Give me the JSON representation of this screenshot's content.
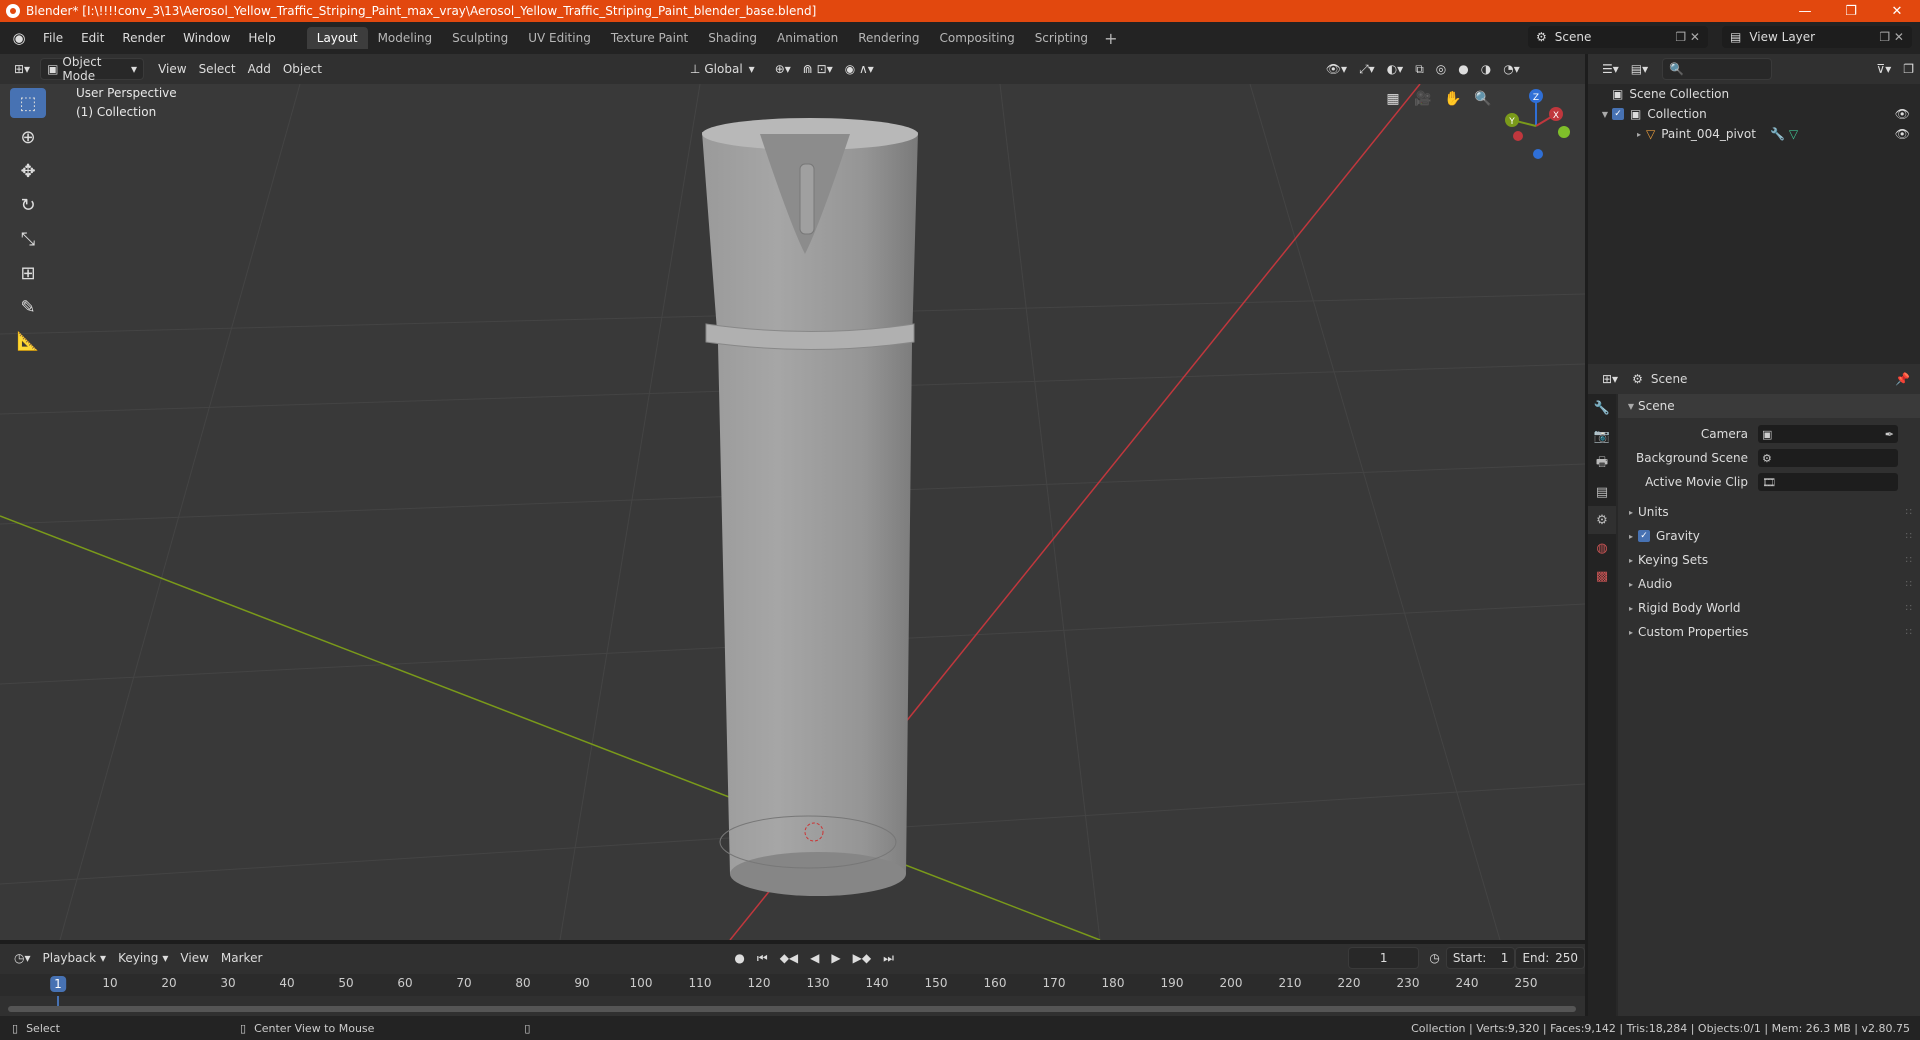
{
  "window": {
    "title": "Blender* [I:\\!!!!conv_3\\13\\Aerosol_Yellow_Traffic_Striping_Paint_max_vray\\Aerosol_Yellow_Traffic_Striping_Paint_blender_base.blend]",
    "min": "—",
    "max": "❐",
    "close": "✕"
  },
  "menus": [
    "File",
    "Edit",
    "Render",
    "Window",
    "Help"
  ],
  "workspaces": [
    "Layout",
    "Modeling",
    "Sculpting",
    "UV Editing",
    "Texture Paint",
    "Shading",
    "Animation",
    "Rendering",
    "Compositing",
    "Scripting"
  ],
  "workspace_add": "+",
  "scene_field": "Scene",
  "view_layer_field": "View Layer",
  "viewport": {
    "mode": "Object Mode",
    "menus": [
      "View",
      "Select",
      "Add",
      "Object"
    ],
    "orientation": "Global",
    "perspective": "User Perspective",
    "collection": "(1) Collection",
    "gizmo": {
      "x": "X",
      "y": "Y",
      "z": "Z"
    }
  },
  "outliner": {
    "root": "Scene Collection",
    "collection": "Collection",
    "object": "Paint_004_pivot"
  },
  "properties": {
    "context": "Scene",
    "panel": "Scene",
    "fields": [
      {
        "label": "Camera",
        "value": ""
      },
      {
        "label": "Background Scene",
        "value": ""
      },
      {
        "label": "Active Movie Clip",
        "value": ""
      }
    ],
    "subpanels": [
      "Units",
      "Gravity",
      "Keying Sets",
      "Audio",
      "Rigid Body World",
      "Custom Properties"
    ]
  },
  "timeline": {
    "menus": [
      "Playback",
      "Keying",
      "View",
      "Marker"
    ],
    "current_frame": "1",
    "start_label": "Start:",
    "start": "1",
    "end_label": "End:",
    "end": "250",
    "ruler": [
      "1",
      "10",
      "20",
      "30",
      "40",
      "50",
      "60",
      "70",
      "80",
      "90",
      "100",
      "110",
      "120",
      "130",
      "140",
      "150",
      "160",
      "170",
      "180",
      "190",
      "200",
      "210",
      "220",
      "230",
      "240",
      "250"
    ]
  },
  "status": {
    "left": "Select",
    "middle": "Center View to Mouse",
    "right": "Collection | Verts:9,320 | Faces:9,142 | Tris:18,284 | Objects:0/1 | Mem: 26.3 MB | v2.80.75"
  },
  "colors": {
    "accent": "#4772b3",
    "titlebar": "#e2480e",
    "x_axis": "#c0373d",
    "y_axis": "#7a9a1a"
  }
}
